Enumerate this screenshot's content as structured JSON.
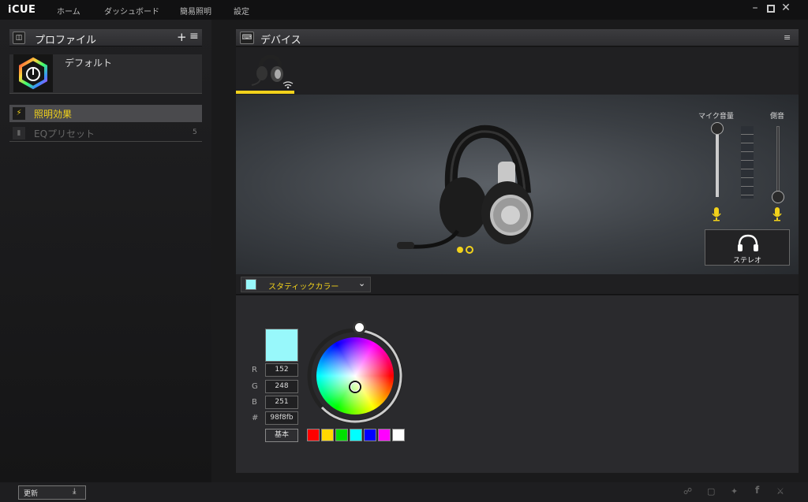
{
  "app": {
    "name": "iCUE"
  },
  "nav": {
    "home": "ホーム",
    "dashboard": "ダッシュボード",
    "simple_lighting": "簡易照明",
    "settings": "設定"
  },
  "profiles": {
    "header": "プロファイル",
    "items": [
      {
        "name": "デフォルト"
      }
    ]
  },
  "left_menu": {
    "lighting": "照明効果",
    "eq": "EQプリセット",
    "eq_count": "5"
  },
  "devices": {
    "header": "デバイス"
  },
  "mic": {
    "volume_label": "マイク音量",
    "sidetone_label": "側音",
    "stereo_label": "ステレオ",
    "volume_level": 1.0,
    "sidetone_level": 0.0
  },
  "effect": {
    "selected": "スタティックカラー"
  },
  "color": {
    "r_label": "R",
    "g_label": "G",
    "b_label": "B",
    "hex_label": "#",
    "r": "152",
    "g": "248",
    "b": "251",
    "hex": "98f8fb",
    "basic_button": "基本",
    "current": "#98f8fb"
  },
  "swatches": [
    "#ff0000",
    "#ffd800",
    "#00e000",
    "#00ffff",
    "#0000ff",
    "#ff00ff",
    "#ffffff"
  ],
  "status": {
    "update_label": "更新"
  },
  "theme": {
    "accent": "#f2d21b"
  }
}
